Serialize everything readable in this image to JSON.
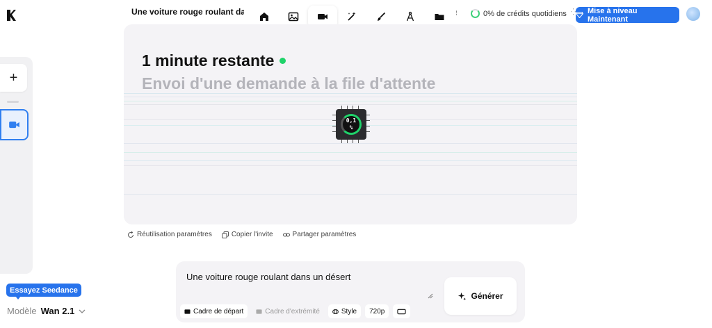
{
  "header": {
    "title": "Une voiture rouge roulant dans un désert",
    "credits_text": "0% de crédits  quotidiens",
    "upgrade_label": "Mise à niveau Maintenant"
  },
  "toolbar": {
    "items": [
      {
        "icon": "home-icon"
      },
      {
        "icon": "image-icon"
      },
      {
        "icon": "video-icon",
        "active": true
      },
      {
        "icon": "magic-wand-icon"
      },
      {
        "icon": "brush-icon"
      },
      {
        "icon": "compass-icon"
      },
      {
        "icon": "folder-icon"
      }
    ]
  },
  "status": {
    "title": "1 minute restante",
    "subtitle": "Envoi d'une demande à la file d'attente",
    "progress_line1": "0,1",
    "progress_line2": "%",
    "progress_value": 0.001
  },
  "actions": {
    "reuse": "Réutilisation paramètres",
    "copy": "Copier l'invite",
    "share": "Partager paramètres"
  },
  "prompt": {
    "text": "Une voiture rouge roulant dans un désert",
    "generate_label": "Générer",
    "start_frame": "Cadre de départ",
    "end_frame": "Cadre d'extrémité",
    "style": "Style",
    "resolution": "720p"
  },
  "sidebar": {
    "add_label": "+"
  },
  "model": {
    "promo": "Essayez Seedance",
    "label": "Modèle",
    "value": "Wan 2.1"
  },
  "colors": {
    "accent": "#2773ec",
    "success": "#1fd36a"
  }
}
